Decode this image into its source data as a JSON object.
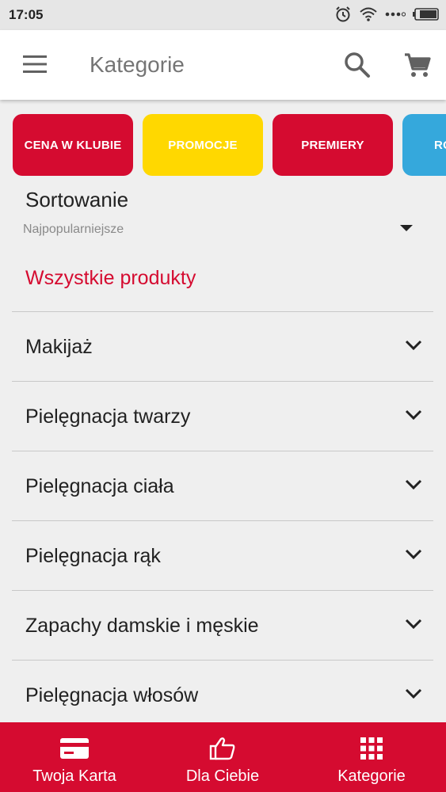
{
  "status": {
    "time": "17:05"
  },
  "appbar": {
    "title": "Kategorie"
  },
  "chips": [
    "CENA W KLUBIE",
    "PROMOCJE",
    "PREMIERY",
    "RO"
  ],
  "sort": {
    "title": "Sortowanie",
    "value": "Najpopularniejsze"
  },
  "all_products": "Wszystkie produkty",
  "categories": [
    "Makijaż",
    "Pielęgnacja twarzy",
    "Pielęgnacja ciała",
    "Pielęgnacja rąk",
    "Zapachy damskie i męskie",
    "Pielęgnacja włosów"
  ],
  "bottom_nav": [
    "Twoja Karta",
    "Dla Ciebie",
    "Kategorie"
  ],
  "colors": {
    "accent": "#d50b30",
    "yellow": "#ffd800",
    "blue": "#35a8dc"
  }
}
